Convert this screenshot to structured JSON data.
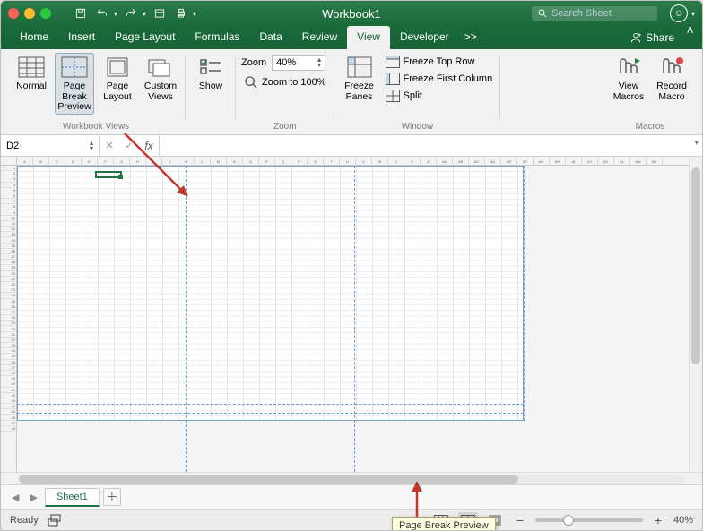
{
  "window_title": "Workbook1",
  "search": {
    "placeholder": "Search Sheet"
  },
  "tabs": {
    "items": [
      "Home",
      "Insert",
      "Page Layout",
      "Formulas",
      "Data",
      "Review",
      "View",
      "Developer"
    ],
    "overflow": ">>",
    "share": "Share"
  },
  "ribbon": {
    "workbook_views": {
      "normal": "Normal",
      "page_break_preview": "Page Break\nPreview",
      "page_layout": "Page\nLayout",
      "custom_views": "Custom\nViews",
      "group_label": "Workbook Views"
    },
    "show": {
      "label": "Show"
    },
    "zoom": {
      "label": "Zoom",
      "value": "40%",
      "zoom_100": "Zoom to 100%",
      "group_label": "Zoom"
    },
    "window": {
      "freeze_panes": "Freeze\nPanes",
      "freeze_top": "Freeze Top Row",
      "freeze_first": "Freeze First Column",
      "split": "Split",
      "group_label": "Window"
    },
    "macros": {
      "view_macros": "View\nMacros",
      "record_macro": "Record\nMacro",
      "group_label": "Macros"
    }
  },
  "formula_bar": {
    "name_box": "D2",
    "formula": ""
  },
  "sheet": {
    "tabs": [
      "Sheet1"
    ]
  },
  "status": {
    "ready": "Ready",
    "zoom": "40%"
  },
  "tooltip": "Page Break Preview"
}
